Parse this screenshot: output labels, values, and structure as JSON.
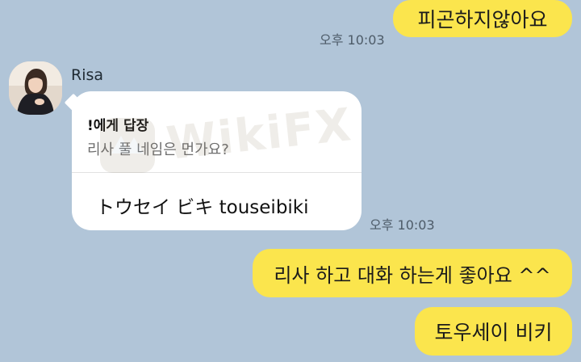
{
  "messages": {
    "m1": {
      "text": "피곤하지않아요",
      "time": "오후 10:03"
    },
    "m2": {
      "sender": "Risa",
      "reply_to": "!에게 답장",
      "quoted": "리사 풀 네임은 먼가요?",
      "text": "トウセイ ビキ  touseibiki",
      "time": "오후 10:03"
    },
    "m3": {
      "text": "리사 하고 대화 하는게 좋아요 ^^"
    },
    "m4": {
      "text": "토우세이 비키"
    }
  },
  "watermark": {
    "text": "WikiFX"
  },
  "colors": {
    "background": "#b1c5d8",
    "my_bubble": "#fbe54d",
    "their_bubble": "#ffffff",
    "time_text": "#4d5b68"
  }
}
